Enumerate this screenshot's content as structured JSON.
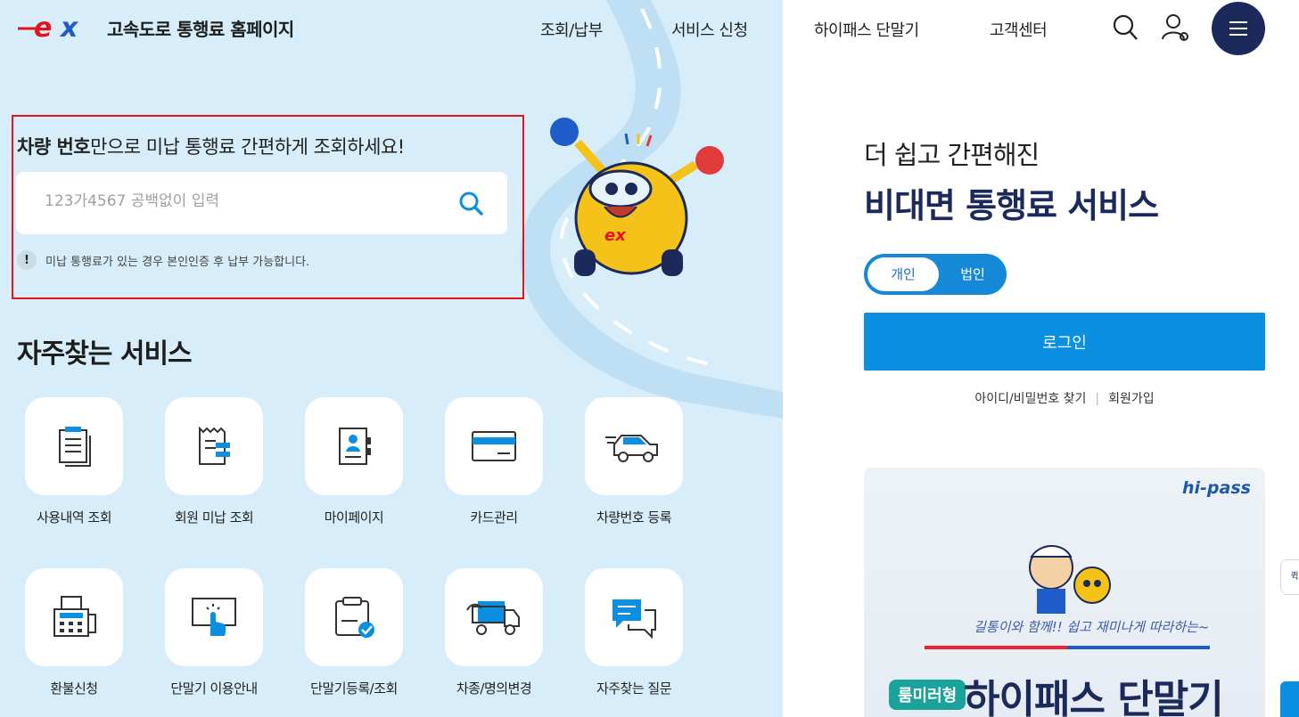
{
  "header": {
    "site_title": "고속도로 통행료 홈페이지",
    "logo_alt": "ex",
    "nav": [
      "조회/납부",
      "서비스 신청",
      "하이패스 단말기",
      "고객센터"
    ]
  },
  "search": {
    "title_bold": "차량 번호",
    "title_rest": "만으로 미납 통행료 간편하게 조회하세요!",
    "placeholder": "123가4567 공백없이 입력",
    "notice_mark": "!",
    "notice": "미납 통행료가 있는 경우 본인인증 후 납부 가능합니다."
  },
  "services": {
    "title": "자주찾는 서비스",
    "items": [
      {
        "label": "사용내역 조회",
        "icon": "document-list-icon"
      },
      {
        "label": "회원 미납 조회",
        "icon": "receipt-icon"
      },
      {
        "label": "마이페이지",
        "icon": "profile-card-icon"
      },
      {
        "label": "카드관리",
        "icon": "card-icon"
      },
      {
        "label": "차량번호 등록",
        "icon": "car-icon"
      },
      {
        "label": "환불신청",
        "icon": "fax-icon"
      },
      {
        "label": "단말기 이용안내",
        "icon": "touch-screen-icon"
      },
      {
        "label": "단말기등록/조회",
        "icon": "clipboard-check-icon"
      },
      {
        "label": "차종/명의변경",
        "icon": "truck-icon"
      },
      {
        "label": "자주찾는 질문",
        "icon": "chat-icon"
      }
    ]
  },
  "panel": {
    "subtitle": "더 쉽고 간편해진",
    "title": "비대면 통행료 서비스",
    "toggle": {
      "personal": "개인",
      "corporate": "법인"
    },
    "login": "로그인",
    "find_account": "아이디/비밀번호 찾기",
    "separator": "|",
    "signup": "회원가입"
  },
  "banner": {
    "brand": "hi-pass",
    "tagline": "길통이와 함께!! 쉽고 재미나게 따라하는~",
    "badge": "룸미러형",
    "headline": "하이패스 단말기"
  },
  "edge": {
    "chip": "퀵"
  },
  "colors": {
    "navy": "#1b2a5a",
    "blue": "#0b8fe0",
    "red": "#e4141c",
    "left_bg": "#d7eefa"
  }
}
